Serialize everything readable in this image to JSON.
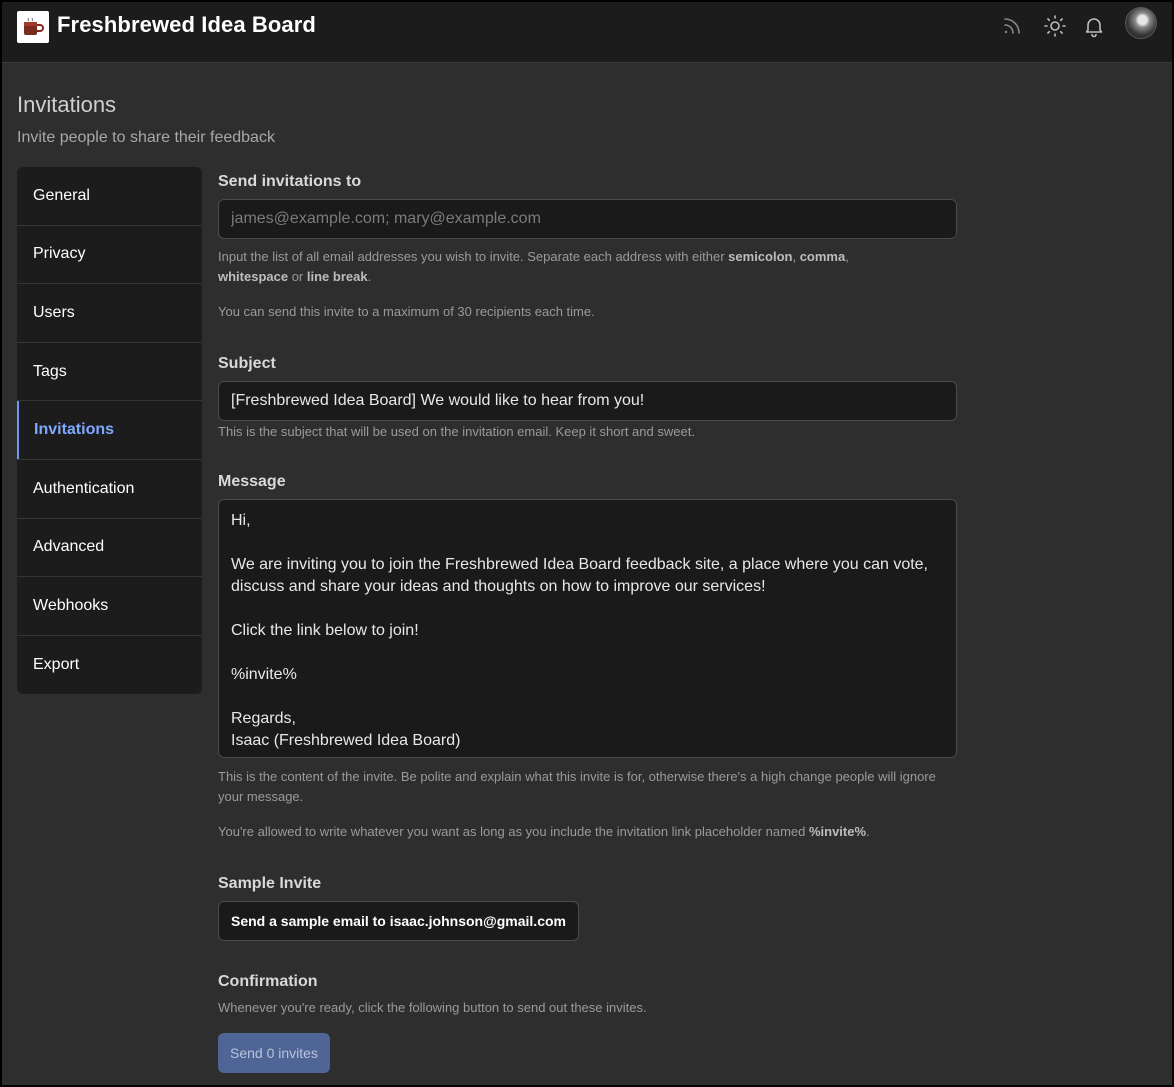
{
  "header": {
    "site_title": "Freshbrewed Idea Board",
    "icons": [
      "rss-icon",
      "sun-icon",
      "bell-icon"
    ]
  },
  "page": {
    "title": "Invitations",
    "subtitle": "Invite people to share their feedback"
  },
  "sidebar": {
    "items": [
      {
        "label": "General"
      },
      {
        "label": "Privacy"
      },
      {
        "label": "Users"
      },
      {
        "label": "Tags"
      },
      {
        "label": "Invitations",
        "active": true
      },
      {
        "label": "Authentication"
      },
      {
        "label": "Advanced"
      },
      {
        "label": "Webhooks"
      },
      {
        "label": "Export"
      }
    ]
  },
  "form": {
    "recipients": {
      "label": "Send invitations to",
      "placeholder": "james@example.com; mary@example.com",
      "value": "",
      "help_1_prefix": "Input the list of all email addresses you wish to invite. Separate each address with either ",
      "help_1_semicolon": "semicolon",
      "help_1_sep1": ", ",
      "help_1_comma": "comma",
      "help_1_sep2": ", ",
      "help_1_whitespace": "whitespace",
      "help_1_or": " or ",
      "help_1_linebreak": "line break",
      "help_1_end": ".",
      "help_2": "You can send this invite to a maximum of 30 recipients each time."
    },
    "subject": {
      "label": "Subject",
      "value": "[Freshbrewed Idea Board] We would like to hear from you!",
      "help": "This is the subject that will be used on the invitation email. Keep it short and sweet."
    },
    "message": {
      "label": "Message",
      "value": "Hi,\n\nWe are inviting you to join the Freshbrewed Idea Board feedback site, a place where you can vote, discuss and share your ideas and thoughts on how to improve our services!\n\nClick the link below to join!\n\n%invite%\n\nRegards,\nIsaac (Freshbrewed Idea Board)",
      "help_1": "This is the content of the invite. Be polite and explain what this invite is for, otherwise there's a high change people will ignore your message.",
      "help_2_prefix": "You're allowed to write whatever you want as long as you include the invitation link placeholder named ",
      "help_2_placeholder": "%invite%",
      "help_2_end": "."
    },
    "sample": {
      "label": "Sample Invite",
      "button": "Send a sample email to isaac.johnson@gmail.com"
    },
    "confirmation": {
      "label": "Confirmation",
      "help": "Whenever you're ready, click the following button to send out these invites.",
      "button": "Send 0 invites"
    }
  },
  "colors": {
    "accent": "#7fa8ff",
    "send_button": "#4f6596",
    "background": "#2e2e2e",
    "header_bg": "#1c1c1c"
  }
}
